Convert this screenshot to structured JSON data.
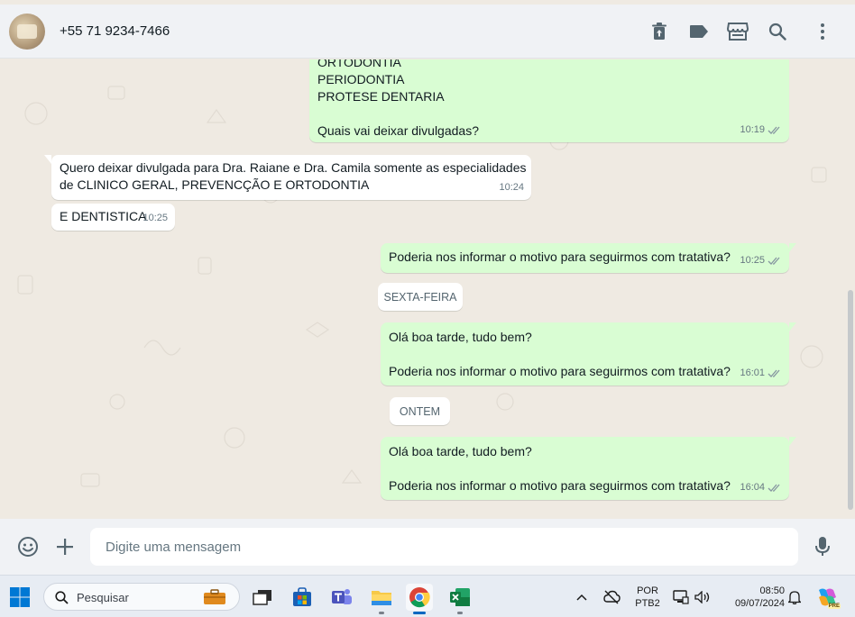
{
  "header": {
    "contact_name": "+55 71 9234-7466",
    "icons": [
      "delete-icon",
      "label-icon",
      "store-icon",
      "search-icon",
      "menu-icon"
    ]
  },
  "messages": [
    {
      "type": "out",
      "text": "ORTODONTIA\nPERIODONTIA\nPROTESE DENTARIA\n\nQuais vai deixar divulgadas?",
      "time": "10:19",
      "status": "read"
    },
    {
      "type": "in",
      "text": "Quero deixar divulgada para Dra. Raiane e Dra. Camila somente as especialidades\nde CLINICO GERAL, PREVENCÇÃO E ORTODONTIA",
      "time": "10:24"
    },
    {
      "type": "in",
      "text": "E DENTISTICA",
      "time": "10:25"
    },
    {
      "type": "out",
      "text": "Poderia nos informar o motivo para seguirmos com tratativa?",
      "time": "10:25",
      "status": "read"
    },
    {
      "type": "out",
      "text": "Olá boa tarde, tudo bem?\n\nPoderia nos informar o motivo para seguirmos com tratativa?",
      "time": "16:01",
      "status": "read"
    },
    {
      "type": "out",
      "text": "Olá boa tarde, tudo bem?\n\nPoderia nos informar o motivo para seguirmos com tratativa?",
      "time": "16:04",
      "status": "read"
    }
  ],
  "date_chips": [
    "SEXTA-FEIRA",
    "ONTEM"
  ],
  "composer": {
    "placeholder": "Digite uma mensagem"
  },
  "taskbar": {
    "search_label": "Pesquisar",
    "language": "POR",
    "layout": "PTB2",
    "time": "08:50",
    "date": "09/07/2024",
    "copilot_badge": "PRE"
  },
  "colors": {
    "outgoing_bubble": "#d9fdd3",
    "incoming_bubble": "#ffffff",
    "read_ticks": "#8696a0",
    "background": "#efeae2"
  }
}
